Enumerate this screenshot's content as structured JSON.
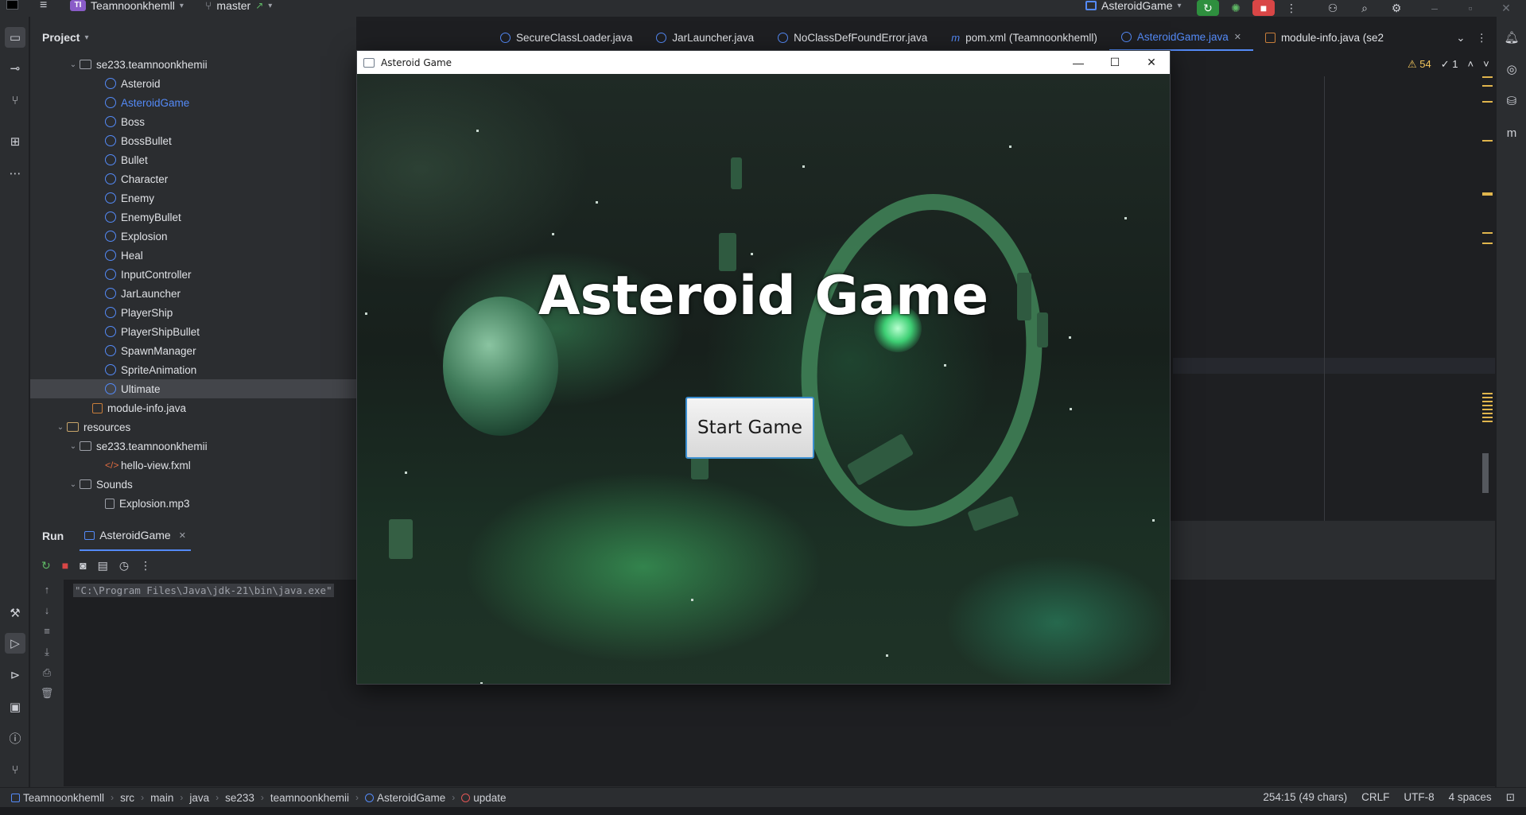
{
  "toolbar": {
    "project_badge": "TI",
    "project_name": "Teamnoonkhemll",
    "branch": "master",
    "run_config": "AsteroidGame"
  },
  "project_panel": {
    "title": "Project",
    "items": [
      {
        "label": "se233.teamnoonkhemii",
        "kind": "folder",
        "indent": 4,
        "expanded": true
      },
      {
        "label": "Asteroid",
        "kind": "class",
        "indent": 6
      },
      {
        "label": "AsteroidGame",
        "kind": "class",
        "indent": 6,
        "active": true
      },
      {
        "label": "Boss",
        "kind": "class",
        "indent": 6
      },
      {
        "label": "BossBullet",
        "kind": "class",
        "indent": 6
      },
      {
        "label": "Bullet",
        "kind": "class",
        "indent": 6
      },
      {
        "label": "Character",
        "kind": "class",
        "indent": 6
      },
      {
        "label": "Enemy",
        "kind": "class",
        "indent": 6
      },
      {
        "label": "EnemyBullet",
        "kind": "class",
        "indent": 6
      },
      {
        "label": "Explosion",
        "kind": "class",
        "indent": 6
      },
      {
        "label": "Heal",
        "kind": "class",
        "indent": 6
      },
      {
        "label": "InputController",
        "kind": "class",
        "indent": 6
      },
      {
        "label": "JarLauncher",
        "kind": "class",
        "indent": 6
      },
      {
        "label": "PlayerShip",
        "kind": "class",
        "indent": 6
      },
      {
        "label": "PlayerShipBullet",
        "kind": "class",
        "indent": 6
      },
      {
        "label": "SpawnManager",
        "kind": "class",
        "indent": 6
      },
      {
        "label": "SpriteAnimation",
        "kind": "class",
        "indent": 6
      },
      {
        "label": "Ultimate",
        "kind": "class",
        "indent": 6,
        "selected": true
      },
      {
        "label": "module-info.java",
        "kind": "java",
        "indent": 5
      },
      {
        "label": "resources",
        "kind": "res",
        "indent": 3,
        "expanded": true
      },
      {
        "label": "se233.teamnoonkhemii",
        "kind": "folder",
        "indent": 4,
        "expanded": true
      },
      {
        "label": "hello-view.fxml",
        "kind": "xml",
        "indent": 6
      },
      {
        "label": "Sounds",
        "kind": "folder",
        "indent": 4,
        "expanded": true
      },
      {
        "label": "Explosion.mp3",
        "kind": "media",
        "indent": 6
      }
    ]
  },
  "editor": {
    "tabs": [
      {
        "label": "SecureClassLoader.java",
        "icon": "c"
      },
      {
        "label": "JarLauncher.java",
        "icon": "c"
      },
      {
        "label": "NoClassDefFoundError.java",
        "icon": "c"
      },
      {
        "label": "pom.xml (Teamnoonkhemll)",
        "icon": "m"
      },
      {
        "label": "AsteroidGame.java",
        "icon": "c",
        "active": true
      },
      {
        "label": "module-info.java (se2",
        "icon": "j"
      }
    ],
    "warnings": "54",
    "errors": "1"
  },
  "run_panel": {
    "title": "Run",
    "tab": "AsteroidGame",
    "console_line": "\"C:\\Program Files\\Java\\jdk-21\\bin\\java.exe\""
  },
  "game_window": {
    "title": "Asteroid Game",
    "heading": "Asteroid Game",
    "start_button": "Start Game"
  },
  "statusbar": {
    "breadcrumbs": [
      "Teamnoonkhemll",
      "src",
      "main",
      "java",
      "se233",
      "teamnoonkhemii",
      "AsteroidGame",
      "update"
    ],
    "position": "254:15 (49 chars)",
    "line_sep": "CRLF",
    "encoding": "UTF-8",
    "indent": "4 spaces"
  },
  "colors": {
    "accent": "#548af7",
    "run_green": "#2e8f3e",
    "stop_red": "#d94646",
    "warning": "#f2c55c"
  }
}
